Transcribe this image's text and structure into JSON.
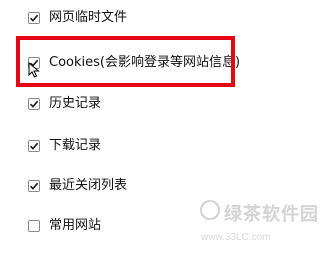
{
  "options": [
    {
      "label": "网页临时文件",
      "checked": true
    },
    {
      "label": "Cookies(会影响登录等网站信息)",
      "checked": true
    },
    {
      "label": "历史记录",
      "checked": true
    },
    {
      "label": "下载记录",
      "checked": true
    },
    {
      "label": "最近关闭列表",
      "checked": true
    },
    {
      "label": "常用网站",
      "checked": false
    }
  ],
  "watermark": {
    "title": "绿茶软件园",
    "url": "www.33LC.com"
  },
  "colors": {
    "highlight_border": "#e30613",
    "checkmark": "#1a1a1a"
  }
}
